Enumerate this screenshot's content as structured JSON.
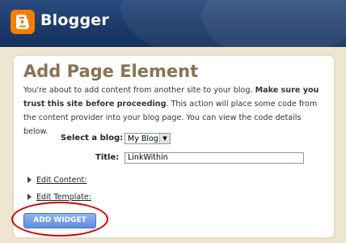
{
  "header": {
    "brand": "Blogger",
    "logo_icon": "blogger-b-icon"
  },
  "panel": {
    "title": "Add Page Element",
    "description": {
      "part1": "You're about to add content from another site to your blog. ",
      "bold": "Make sure you trust this site before proceeding",
      "part2": ". This action will place some code from the content provider into your blog page. You can view the code details below."
    },
    "select_blog": {
      "label": "Select a blog:",
      "value": "My Blog"
    },
    "title_field": {
      "label": "Title:",
      "value": "LinkWithin"
    },
    "expanders": [
      {
        "label": "Edit Content:"
      },
      {
        "label": "Edit Template:"
      }
    ],
    "add_button": "ADD WIDGET"
  },
  "colors": {
    "header_bg": "#1c3a68",
    "brand_orange": "#f57d00",
    "title_brown": "#8a7255",
    "button_blue": "#5e8ee0",
    "highlight_red": "#d40000"
  }
}
